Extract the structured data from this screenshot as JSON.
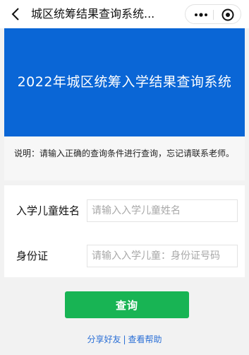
{
  "topbar": {
    "title": "城区统筹结果查询系统...",
    "icons": [
      "back-chevron-icon",
      "more-dots-icon",
      "target-icon"
    ]
  },
  "banner": {
    "text": "2022年城区统筹入学结果查询系统"
  },
  "notice": {
    "text": "说明：请输入正确的查询条件进行查询，忘记请联系老师。"
  },
  "form": {
    "name_label": "入学儿童姓名",
    "name_placeholder": "请输入入学儿童姓名",
    "id_label": "身份证",
    "id_placeholder": "请输入入学儿童：身份证号码"
  },
  "actions": {
    "query_label": "查询",
    "share_label": "分享好友",
    "separator": "|",
    "help_label": "查看帮助"
  },
  "colors": {
    "banner": "#0a66d6",
    "button": "#18b454",
    "link": "#2a6fd6"
  }
}
